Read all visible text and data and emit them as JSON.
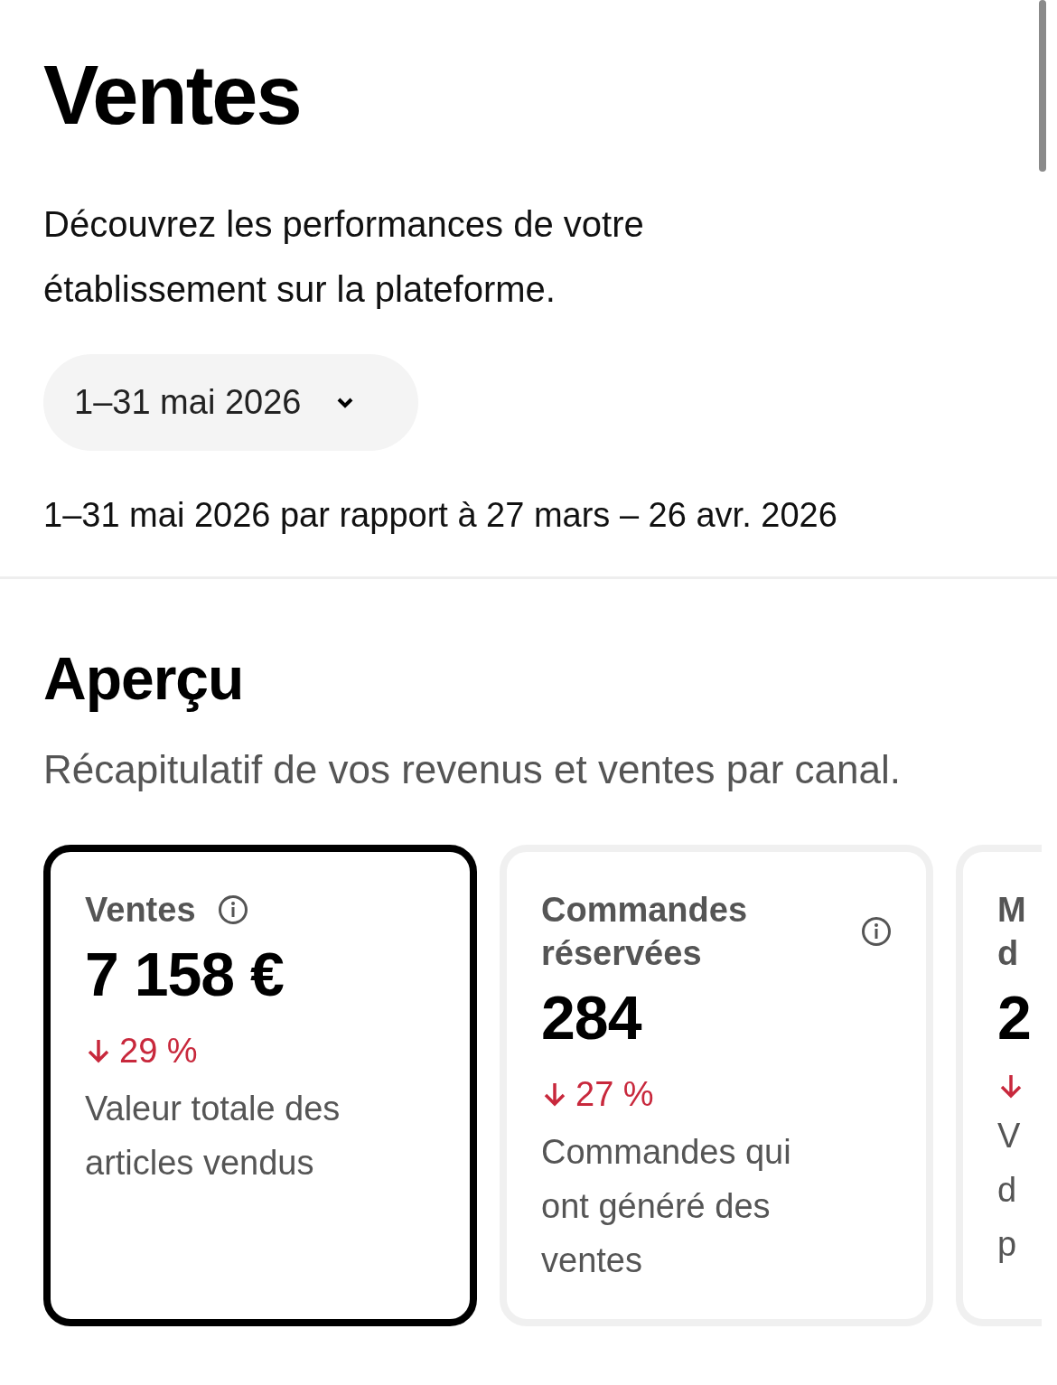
{
  "header": {
    "title": "Ventes",
    "subtitle": "Découvrez les performances de votre établissement sur la plateforme.",
    "date_range": "1–31 mai 2026",
    "comparison": "1–31 mai 2026 par rapport à 27 mars – 26 avr. 2026"
  },
  "overview": {
    "title": "Aperçu",
    "subtitle": "Récapitulatif de vos revenus et ventes par canal.",
    "cards": [
      {
        "kind": "full",
        "selected": true,
        "title": "Ventes",
        "value": "7 158 €",
        "decrease": true,
        "change": "29 %",
        "description": "Valeur totale des articles vendus"
      },
      {
        "kind": "full",
        "selected": false,
        "title": "Commandes réservées",
        "value": "284",
        "decrease": true,
        "change": "27 %",
        "description": "Commandes qui ont généré des ventes"
      },
      {
        "kind": "cut",
        "selected": false,
        "title_lines": [
          "M",
          "d"
        ],
        "value": "2",
        "decrease": true,
        "description_lines": [
          "V",
          "d",
          "p"
        ]
      }
    ]
  }
}
